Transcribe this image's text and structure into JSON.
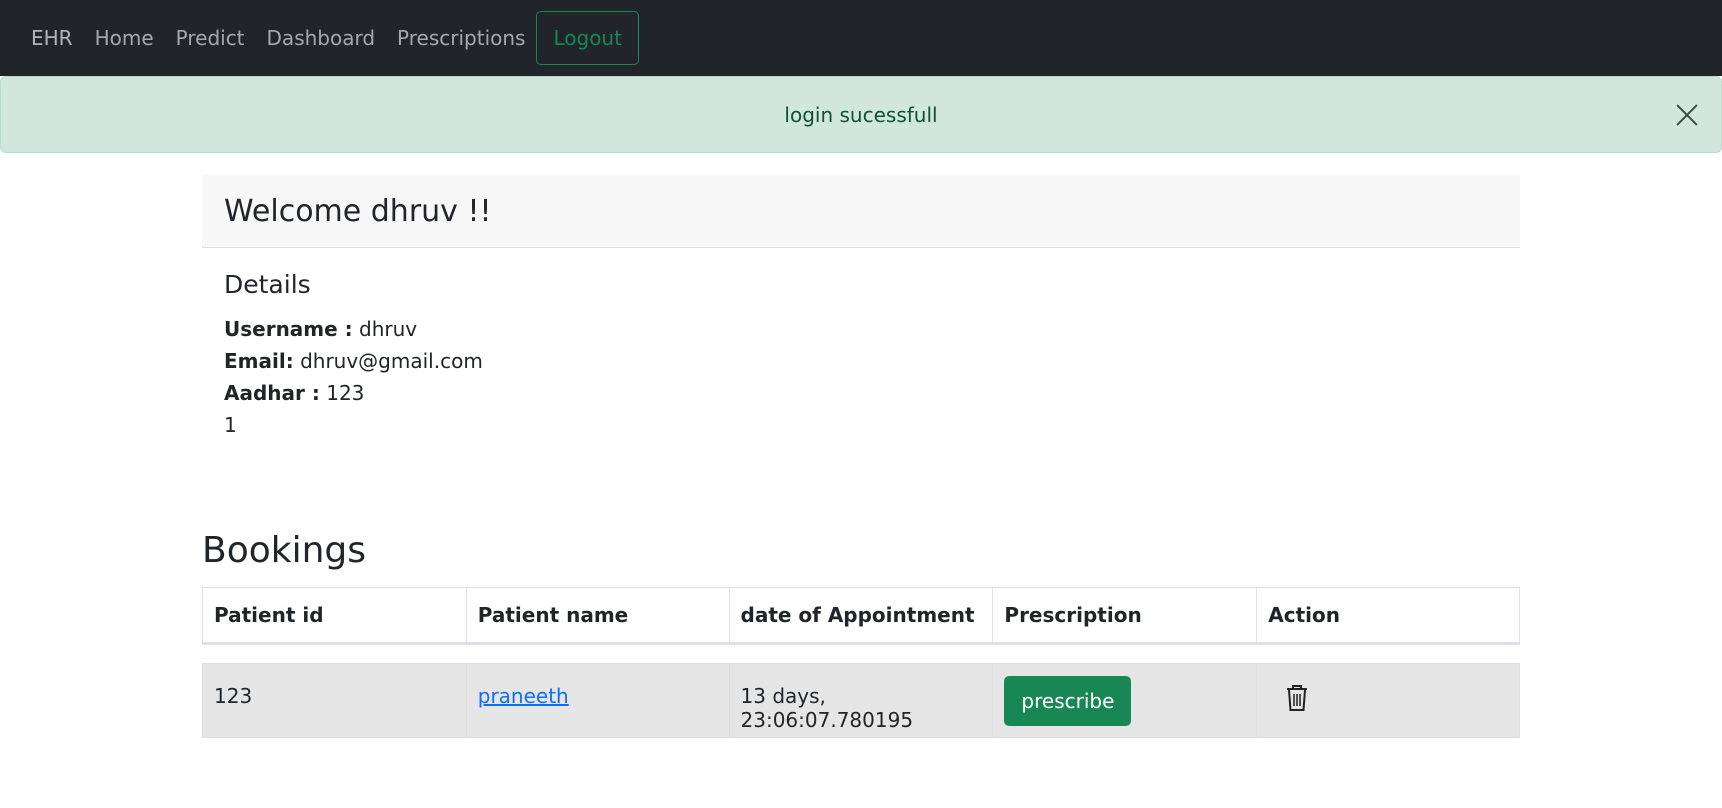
{
  "nav": {
    "brand": "EHR",
    "items": [
      {
        "label": "Home"
      },
      {
        "label": "Predict"
      },
      {
        "label": "Dashboard"
      },
      {
        "label": "Prescriptions"
      }
    ],
    "logout_label": "Logout"
  },
  "alert": {
    "message": "login sucessfull",
    "close_icon": "close-icon"
  },
  "welcome": {
    "title": "Welcome dhruv !!"
  },
  "details": {
    "title": "Details",
    "username_label": "Username :",
    "username_value": "dhruv",
    "email_label": "Email:",
    "email_value": "dhruv@gmail.com",
    "aadhar_label": "Aadhar :",
    "aadhar_value": "123",
    "extra_value": "1"
  },
  "bookings": {
    "title": "Bookings",
    "columns": [
      "Patient id",
      "Patient name",
      "date of Appointment",
      "Prescription",
      "Action"
    ],
    "rows": [
      {
        "patient_id": "123",
        "patient_name": "praneeth",
        "date": "13 days, 23:06:07.780195",
        "prescribe_label": "prescribe",
        "action_icon": "trash-icon"
      }
    ]
  },
  "colors": {
    "navbar_bg": "#212529",
    "alert_bg": "#d1e7dd",
    "success": "#198754",
    "link": "#0d6efd"
  }
}
